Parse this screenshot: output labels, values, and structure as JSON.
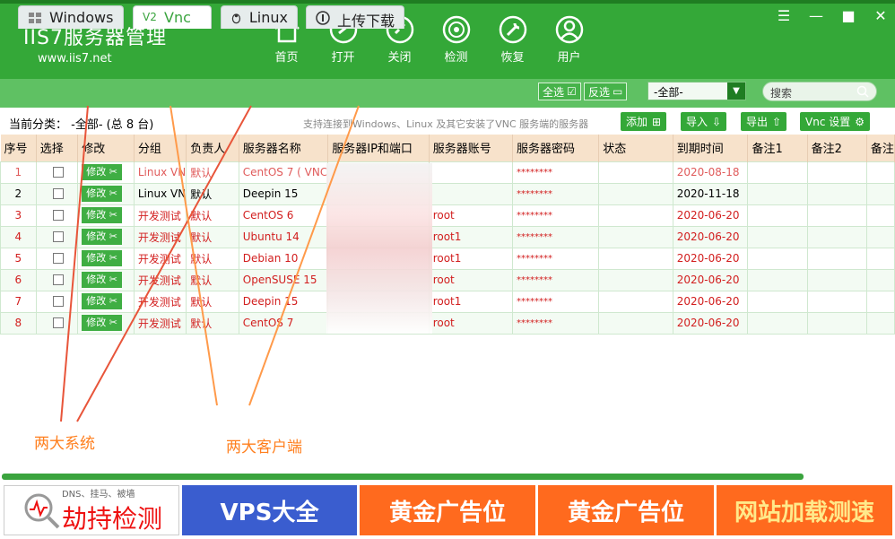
{
  "header": {
    "logo": "IIS7服务器管理",
    "url": "www.iis7.net",
    "nav": [
      {
        "label": "首页",
        "icon": "home-icon"
      },
      {
        "label": "打开",
        "icon": "link-icon"
      },
      {
        "label": "关闭",
        "icon": "unlink-icon"
      },
      {
        "label": "检测",
        "icon": "monitor-icon"
      },
      {
        "label": "恢复",
        "icon": "wrench-icon"
      },
      {
        "label": "用户",
        "icon": "user-icon"
      }
    ],
    "window": {
      "menu": "☰",
      "minimize": "—",
      "maximize": "■",
      "close": "✕"
    }
  },
  "tabs": [
    {
      "label": "Windows",
      "icon": "windows-icon"
    },
    {
      "label": "Vnc",
      "icon": "vnc-icon"
    },
    {
      "label": "Linux",
      "icon": "linux-icon"
    },
    {
      "label": "上传下载",
      "icon": "upload-icon"
    }
  ],
  "toolbar": {
    "select_all": "全选",
    "invert": "反选",
    "category": "-全部-",
    "search_placeholder": "搜索"
  },
  "info": {
    "current": "当前分类： -全部- (总 8 台)",
    "hint": "支持连接到Windows、Linux 及其它安装了VNC 服务端的服务器",
    "add": "添加",
    "import": "导入",
    "export": "导出",
    "vnc_settings": "Vnc 设置"
  },
  "table": {
    "headers": [
      "序号",
      "选择",
      "修改",
      "分组",
      "负责人",
      "服务器名称",
      "服务器IP和端口",
      "服务器账号",
      "服务器密码",
      "状态",
      "到期时间",
      "备注1",
      "备注2",
      "备注"
    ],
    "edit_label": "修改 ✂",
    "rows": [
      {
        "no": "1",
        "group": "Linux VN",
        "owner": "默认",
        "name": "CentOS 7 ( VNC",
        "account": "",
        "password": "********",
        "expire": "2020-08-18"
      },
      {
        "no": "2",
        "group": "Linux VN",
        "owner": "默认",
        "name": "Deepin 15",
        "account": "",
        "password": "********",
        "expire": "2020-11-18"
      },
      {
        "no": "3",
        "group": "开发测试",
        "owner": "默认",
        "name": "CentOS 6",
        "account": "root",
        "password": "********",
        "expire": "2020-06-20"
      },
      {
        "no": "4",
        "group": "开发测试",
        "owner": "默认",
        "name": "Ubuntu 14",
        "account": "root1",
        "password": "********",
        "expire": "2020-06-20"
      },
      {
        "no": "5",
        "group": "开发测试",
        "owner": "默认",
        "name": "Debian 10",
        "account": "root1",
        "password": "********",
        "expire": "2020-06-20"
      },
      {
        "no": "6",
        "group": "开发测试",
        "owner": "默认",
        "name": "OpenSUSE 15",
        "account": "root",
        "password": "********",
        "expire": "2020-06-20"
      },
      {
        "no": "7",
        "group": "开发测试",
        "owner": "默认",
        "name": "Deepin 15",
        "account": "root1",
        "password": "********",
        "expire": "2020-06-20"
      },
      {
        "no": "8",
        "group": "开发测试",
        "owner": "默认",
        "name": "CentOS 7",
        "account": "root",
        "password": "********",
        "expire": "2020-06-20"
      }
    ]
  },
  "annotations": {
    "left": "两大系统",
    "right": "两大客户端"
  },
  "banners": {
    "b1_small": "DNS、挂马、被墙",
    "b1": "劫持检测",
    "b2": "VPS大全",
    "b3": "黄金广告位",
    "b4": "黄金广告位",
    "b5": "网站加载测速"
  },
  "colors": {
    "green": "#34a838",
    "header_row": "#f7e2cb",
    "red_text": "#d21e1e",
    "annotation": "#ff7f1e"
  }
}
